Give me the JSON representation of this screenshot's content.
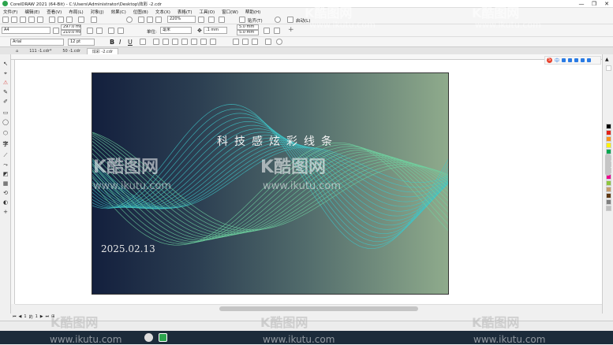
{
  "window": {
    "title": "CorelDRAW 2021 (64-Bit) - C:\\Users\\Administrator\\Desktop\\炫彩 -2.cdr",
    "controls": [
      "—",
      "❐",
      "✕"
    ]
  },
  "menu": [
    "文件(F)",
    "编辑(E)",
    "查看(V)",
    "布局(L)",
    "对象(J)",
    "效果(C)",
    "位图(B)",
    "文本(X)",
    "表格(T)",
    "工具(O)",
    "窗口(W)",
    "帮助(H)"
  ],
  "toolbar": {
    "zoom": "220%",
    "snap_label": "贴齐(T)",
    "launch_label": "启动(L)",
    "page_size": "A4",
    "width": "297.0 mm",
    "height": "210.0 mm",
    "units_label": "单位:",
    "units": "毫米",
    "nudge": ".1 mm",
    "dup_x": "5.0 mm",
    "dup_y": "5.0 mm"
  },
  "textbar": {
    "font": "Arial",
    "size": "12 pt"
  },
  "tabs": [
    {
      "label": "111 -1.cdr*",
      "active": false
    },
    {
      "label": "50 -1.cdr",
      "active": false
    },
    {
      "label": "炫彩 -2.cdr",
      "active": true
    }
  ],
  "artwork": {
    "title": "科技感炫彩线条",
    "date": "2025.02.13",
    "gradient_colors": [
      "#131f3d",
      "#2c3f52",
      "#526c6c",
      "#8fab8c"
    ],
    "line_colors": [
      "#3fc5c8",
      "#6fd3a0"
    ]
  },
  "watermarks": {
    "logo": "K酷图网",
    "url": "www.ikutu.com"
  },
  "page_nav": {
    "current": "1",
    "of": "的",
    "total": "1"
  },
  "palette_colors": [
    "#ffffff",
    "#000000",
    "#e2231a",
    "#f7941d",
    "#fff200",
    "#00a651",
    "#00aeef",
    "#2e3192",
    "#92278f",
    "#ec008c",
    "#8dc63f",
    "#c69c6d",
    "#603913",
    "#7f7f7f",
    "#bfbfbf"
  ],
  "taskbar_icon_colors": [
    "#2da44e",
    "#4a90d9"
  ]
}
